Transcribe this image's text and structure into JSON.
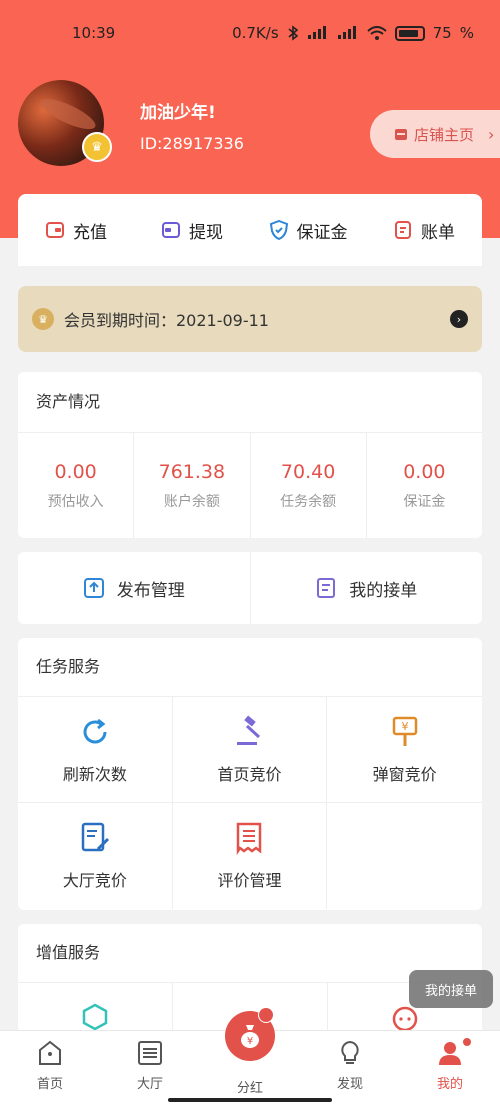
{
  "status_bar": {
    "time": "10:39",
    "speed": "0.7K/s",
    "battery": "75"
  },
  "profile": {
    "name": "加油少年!",
    "id": "ID:28917336",
    "shop_label": "店铺主页"
  },
  "quick_actions": [
    {
      "label": "充值",
      "icon": "wallet-icon",
      "color": "#e2524a"
    },
    {
      "label": "提现",
      "icon": "withdraw-icon",
      "color": "#6b5bd6"
    },
    {
      "label": "保证金",
      "icon": "shield-icon",
      "color": "#2f86d6"
    },
    {
      "label": "账单",
      "icon": "bill-icon",
      "color": "#e2524a"
    }
  ],
  "membership": {
    "text": "会员到期时间：2021-09-11"
  },
  "assets": {
    "title": "资产情况",
    "items": [
      {
        "value": "0.00",
        "label": "预估收入"
      },
      {
        "value": "761.38",
        "label": "账户余额"
      },
      {
        "value": "70.40",
        "label": "任务余额"
      },
      {
        "value": "0.00",
        "label": "保证金"
      }
    ]
  },
  "publish": [
    {
      "label": "发布管理",
      "icon": "upload-icon"
    },
    {
      "label": "我的接单",
      "icon": "orders-icon"
    }
  ],
  "task_services": {
    "title": "任务服务",
    "items": [
      {
        "label": "刷新次数",
        "icon": "refresh-icon"
      },
      {
        "label": "首页竞价",
        "icon": "auction-hammer-icon"
      },
      {
        "label": "弹窗竞价",
        "icon": "yen-sign-icon"
      },
      {
        "label": "大厅竞价",
        "icon": "edit-document-icon"
      },
      {
        "label": "评价管理",
        "icon": "review-list-icon"
      }
    ]
  },
  "value_services": {
    "title": "增值服务"
  },
  "floating_tip": "我的接单",
  "bottom_nav": [
    {
      "label": "首页",
      "icon": "home-icon"
    },
    {
      "label": "大厅",
      "icon": "list-icon"
    },
    {
      "label": "分红",
      "icon": "money-bag-icon"
    },
    {
      "label": "发现",
      "icon": "lightbulb-icon"
    },
    {
      "label": "我的",
      "icon": "user-icon"
    }
  ]
}
